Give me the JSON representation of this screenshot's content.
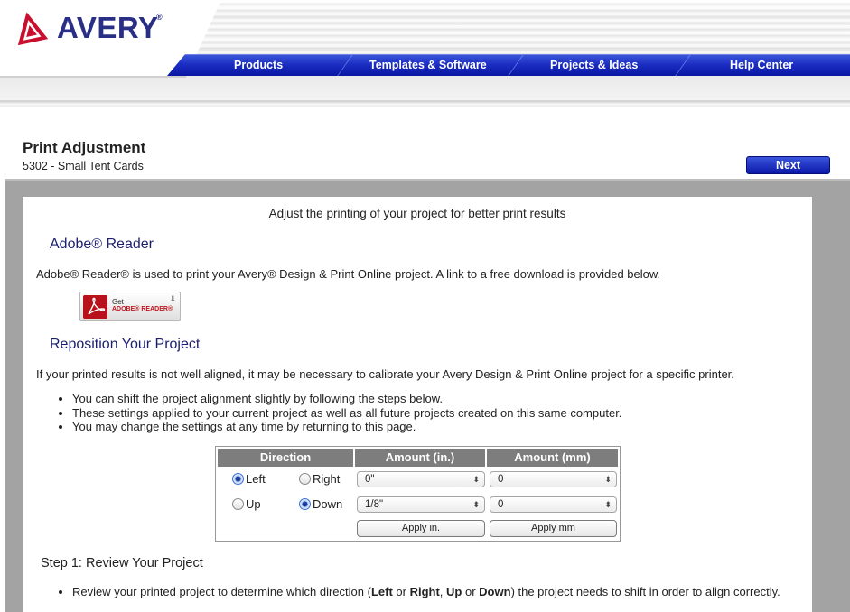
{
  "brand": {
    "name": "AVERY",
    "registered_mark": "®",
    "logo_color": "#2a2f86",
    "logo_mark_color": "#c8102e"
  },
  "nav": {
    "items": [
      {
        "label": "Products"
      },
      {
        "label": "Templates & Software"
      },
      {
        "label": "Projects & Ideas"
      },
      {
        "label": "Help Center"
      }
    ],
    "color": "#1b2ec2"
  },
  "page": {
    "title": "Print Adjustment",
    "subtitle": "5302 - Small Tent Cards",
    "next_label": "Next"
  },
  "content": {
    "intro": "Adjust the printing of your project for better print results",
    "adobe": {
      "heading": "Adobe® Reader",
      "text": "Adobe® Reader® is used to print your Avery® Design & Print Online project. A link to a free download is provided below.",
      "badge_get": "Get",
      "badge_reader": "ADOBE® READER®"
    },
    "reposition": {
      "heading": "Reposition Your Project",
      "text": "If your printed results is not well aligned, it may be necessary to calibrate your Avery Design & Print Online project for a specific printer.",
      "bullets": [
        "You can shift the project alignment slightly by following the steps below.",
        "These settings applied to your current project as well as all future projects created on this same computer.",
        "You may change the settings at any time by returning to this page."
      ]
    },
    "adjust_table": {
      "headers": {
        "direction": "Direction",
        "amount_in": "Amount (in.)",
        "amount_mm": "Amount (mm)"
      },
      "rows": [
        {
          "options": [
            {
              "label": "Left",
              "selected": true
            },
            {
              "label": "Right",
              "selected": false
            }
          ],
          "amount_in": "0\"",
          "amount_mm": "0"
        },
        {
          "options": [
            {
              "label": "Up",
              "selected": false
            },
            {
              "label": "Down",
              "selected": true
            }
          ],
          "amount_in": "1/8\"",
          "amount_mm": "0"
        }
      ],
      "apply_in_label": "Apply in.",
      "apply_mm_label": "Apply mm"
    },
    "step1": {
      "heading": "Step 1: Review Your Project",
      "bullet_pre": "Review your printed project to determine which direction (",
      "left": "Left",
      "or1": " or ",
      "right": "Right",
      "comma": ", ",
      "up": "Up",
      "or2": " or ",
      "down": "Down",
      "bullet_post": ") the project needs to shift in order to align correctly."
    }
  }
}
